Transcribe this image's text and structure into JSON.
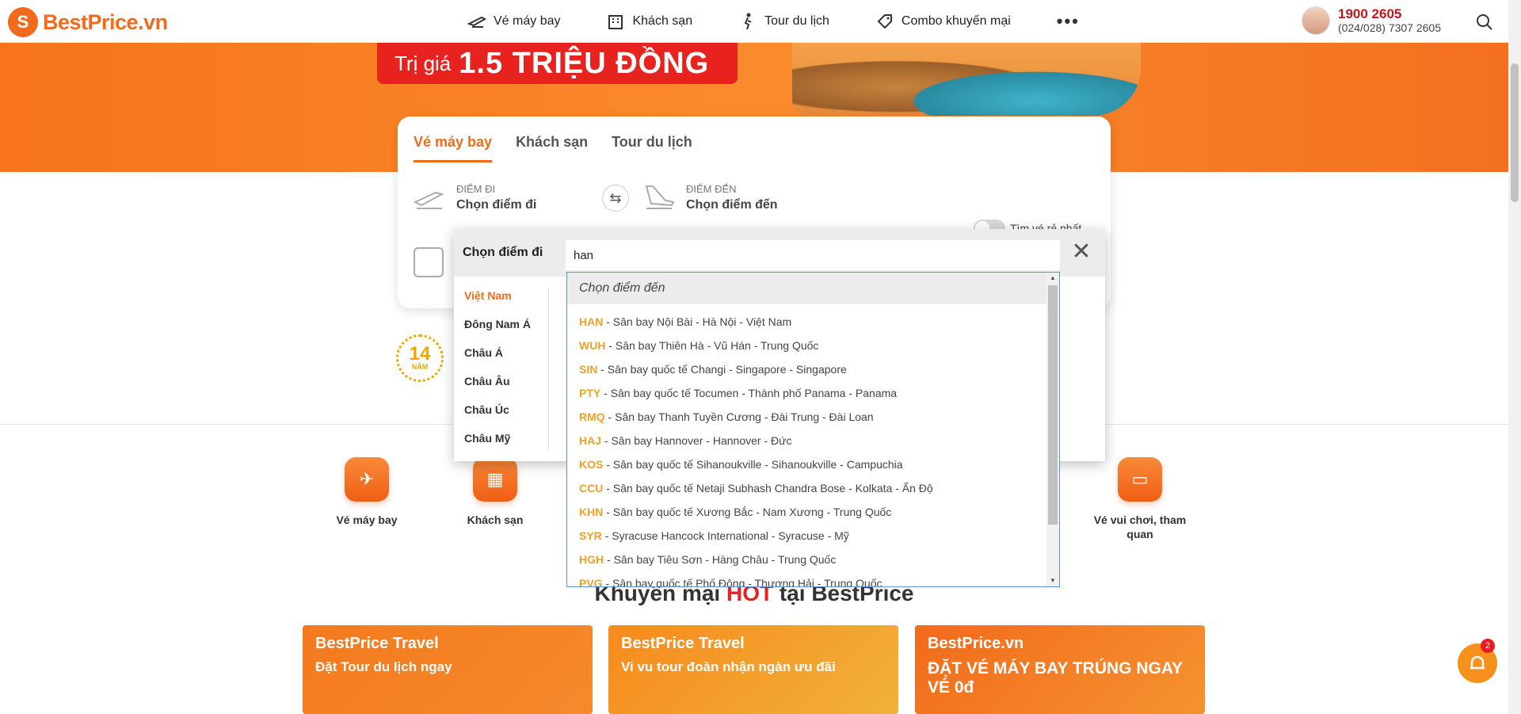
{
  "header": {
    "logo": "BestPrice.vn",
    "nav": [
      {
        "label": "Vé máy bay",
        "icon": "plane-ticket-icon"
      },
      {
        "label": "Khách sạn",
        "icon": "hotel-icon"
      },
      {
        "label": "Tour du lịch",
        "icon": "hiker-icon"
      },
      {
        "label": "Combo khuyến mại",
        "icon": "combo-tag-icon"
      }
    ],
    "more": "•••",
    "hotline": "1900 2605",
    "hotline_sub": "(024/028) 7307 2605"
  },
  "hero": {
    "promo_prefix": "Trị giá",
    "promo_value": "1.5 TRIỆU ĐỒNG"
  },
  "search": {
    "tabs": [
      "Vé máy bay",
      "Khách sạn",
      "Tour du lịch"
    ],
    "active_tab": 0,
    "from_label": "ĐIỂM ĐI",
    "from_value": "Chọn điểm đi",
    "to_label": "ĐIỂM ĐẾN",
    "to_value": "Chọn điểm đến",
    "cheap_toggle": "Tìm vé rẻ nhất"
  },
  "badge": {
    "num": "14",
    "unit": "NĂM"
  },
  "services": [
    "Vé máy bay",
    "Khách sạn",
    "Vé vui chơi, tham quan"
  ],
  "section_title": {
    "pre": "Khuyến mại ",
    "hot": "HOT",
    "post": " tại BestPrice"
  },
  "promos": [
    {
      "brand": "BestPrice Travel",
      "line": "Đặt Tour du lịch ngay"
    },
    {
      "brand": "BestPrice Travel",
      "line": "Vi vu tour đoàn nhận ngàn ưu đãi"
    },
    {
      "brand": "BestPrice.vn",
      "line": "ĐẶT VÉ MÁY BAY TRÚNG NGAY VÉ 0đ"
    }
  ],
  "chat": {
    "count": "2"
  },
  "dropdown": {
    "title": "Chọn điểm đi",
    "query": "han",
    "regions": [
      "Việt Nam",
      "Đông Nam Á",
      "Châu Á",
      "Châu Âu",
      "Châu Úc",
      "Châu Mỹ"
    ],
    "results_header": "Chọn điểm đến",
    "results": [
      {
        "code": "HAN",
        "text": " - Sân bay Nội Bài - Hà Nội - Việt Nam"
      },
      {
        "code": "WUH",
        "text": " - Sân bay Thiên Hà - Vũ Hán - Trung Quốc"
      },
      {
        "code": "SIN",
        "text": " - Sân bay quốc tế Changi - Singapore - Singapore"
      },
      {
        "code": "PTY",
        "text": " - Sân bay quốc tế Tocumen - Thành phố Panama - Panama"
      },
      {
        "code": "RMQ",
        "text": " - Sân bay Thanh Tuyền Cương - Đài Trung - Đài Loan"
      },
      {
        "code": "HAJ",
        "text": " - Sân bay Hannover - Hannover - Đức"
      },
      {
        "code": "KOS",
        "text": " - Sân bay quốc tế Sihanoukville - Sihanoukville - Campuchia"
      },
      {
        "code": "CCU",
        "text": " - Sân bay quốc tế Netaji Subhash Chandra Bose - Kolkata - Ấn Độ"
      },
      {
        "code": "KHN",
        "text": " - Sân bay quốc tế Xương Bắc - Nam Xương - Trung Quốc"
      },
      {
        "code": "SYR",
        "text": " - Syracuse Hancock International - Syracuse - Mỹ"
      },
      {
        "code": "HGH",
        "text": " - Sân bay Tiêu Sơn - Hàng Châu - Trung Quốc"
      },
      {
        "code": "PVG",
        "text": " - Sân bay quốc tế Phố Đông - Thượng Hải - Trung Quốc"
      }
    ]
  },
  "colors": {
    "brand": "#f26a1b",
    "hot": "#e8221f",
    "code": "#f0a02a"
  }
}
